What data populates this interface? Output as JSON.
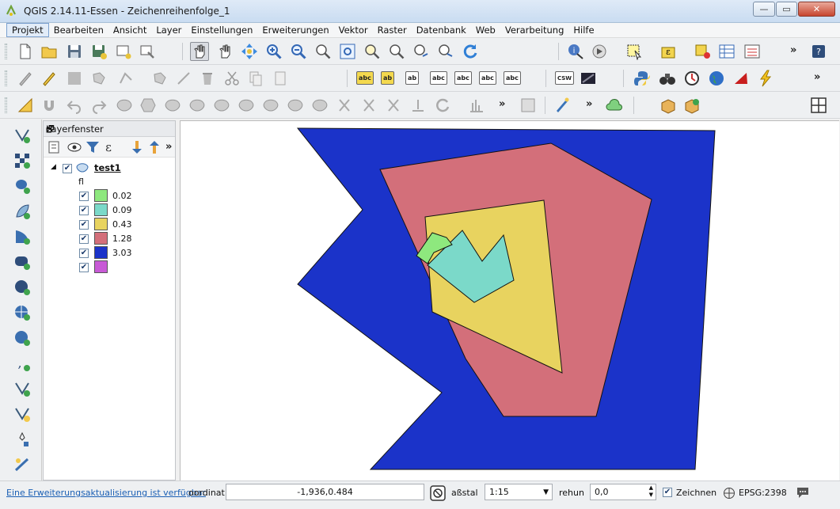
{
  "window": {
    "title": "QGIS 2.14.11-Essen - Zeichenreihenfolge_1",
    "minimize": "—",
    "maximize": "▭",
    "close": "✕"
  },
  "menu": [
    "Projekt",
    "Bearbeiten",
    "Ansicht",
    "Layer",
    "Einstellungen",
    "Erweiterungen",
    "Vektor",
    "Raster",
    "Datenbank",
    "Web",
    "Verarbeitung",
    "Hilfe"
  ],
  "toolbar_more": "»",
  "label_icons": [
    "abc",
    "ab",
    "ab",
    "abc",
    "abc",
    "abc",
    "abc"
  ],
  "csw_label": "CSW",
  "layer_panel": {
    "title": "Layerfenster",
    "float": "🗗",
    "close": "✕",
    "layer_name": "test1",
    "attribute": "fl",
    "classes": [
      {
        "label": "0.02",
        "color": "#8ee87e"
      },
      {
        "label": "0.09",
        "color": "#7bd9c9"
      },
      {
        "label": "0.43",
        "color": "#e8d35f"
      },
      {
        "label": "1.28",
        "color": "#d36f7a"
      },
      {
        "label": "3.03",
        "color": "#1b33c9"
      },
      {
        "label": "",
        "color": "#c85ad6"
      }
    ]
  },
  "map": {
    "colors": {
      "blue": "#1b33c9",
      "pink": "#d36f7a",
      "yellow": "#e8d35f",
      "teal": "#7bd9c9",
      "green": "#8ee87e"
    }
  },
  "status": {
    "plugin_update": "Eine Erweiterungsaktualisierung ist verfügbar",
    "coord_label": "oordinat",
    "coord_value": "-1,936,0.484",
    "scale_label": "aßstal",
    "scale_value": "1:15",
    "rotation_label": "rehun",
    "rotation_value": "0,0",
    "render_label": "Zeichnen",
    "crs": "EPSG:2398"
  }
}
